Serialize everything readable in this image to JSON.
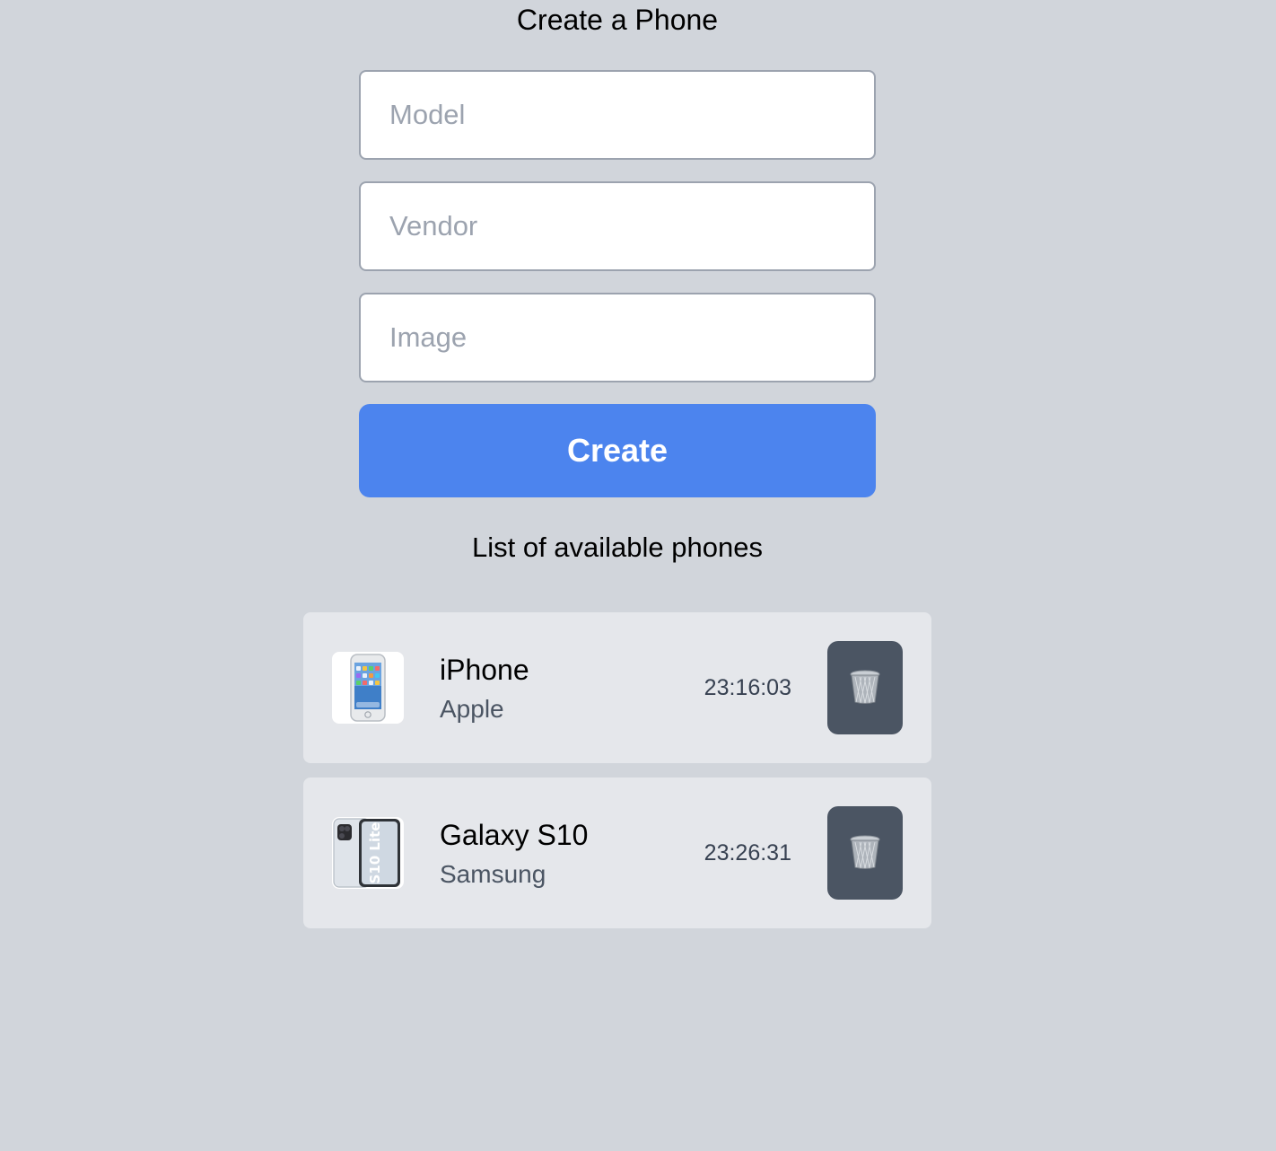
{
  "form": {
    "title": "Create a Phone",
    "model_placeholder": "Model",
    "vendor_placeholder": "Vendor",
    "image_placeholder": "Image",
    "create_label": "Create"
  },
  "list": {
    "title": "List of available phones",
    "items": [
      {
        "model": "iPhone",
        "vendor": "Apple",
        "time": "23:16:03",
        "image_icon": "iphone-image",
        "delete_icon": "trash-icon"
      },
      {
        "model": "Galaxy S10",
        "vendor": "Samsung",
        "time": "23:26:31",
        "image_icon": "galaxy-s10-lite-image",
        "delete_icon": "trash-icon"
      }
    ]
  },
  "colors": {
    "background": "#d1d5db",
    "create_button": "#4c84ee",
    "card": "#e5e7eb",
    "delete_button": "#4b5563"
  }
}
